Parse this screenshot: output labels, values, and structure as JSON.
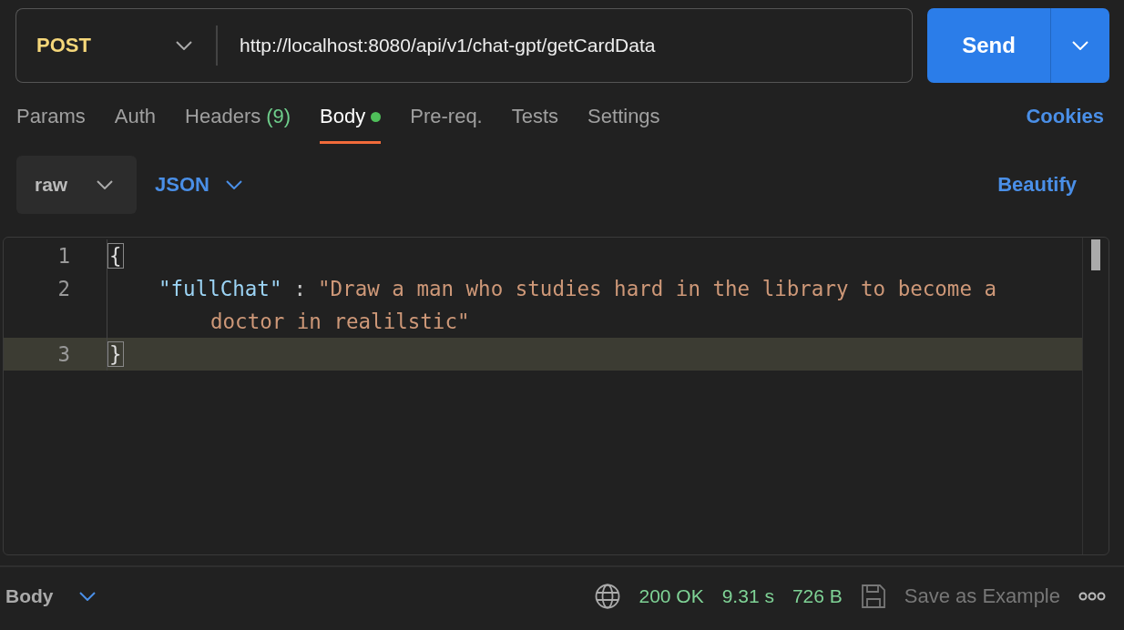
{
  "request": {
    "method": "POST",
    "url": "http://localhost:8080/api/v1/chat-gpt/getCardData",
    "send": "Send"
  },
  "tabs": [
    {
      "label": "Params",
      "selected": false,
      "dot": false
    },
    {
      "label": "Auth",
      "selected": false,
      "dot": false
    },
    {
      "label": "Headers",
      "count": "(9)",
      "selected": false,
      "dot": false
    },
    {
      "label": "Body",
      "selected": true,
      "dot": true
    },
    {
      "label": "Pre-req.",
      "selected": false,
      "dot": false
    },
    {
      "label": "Tests",
      "selected": false,
      "dot": false
    },
    {
      "label": "Settings",
      "selected": false,
      "dot": false
    }
  ],
  "cookies": "Cookies",
  "body_options": {
    "mode": "raw",
    "language": "JSON",
    "beautify": "Beautify"
  },
  "editor": {
    "lines": [
      {
        "number": "1",
        "kind": "brace",
        "text": "{",
        "current": false
      },
      {
        "number": "2",
        "kind": "pair",
        "key": "\"fullChat\"",
        "separator": ":",
        "value_lines": [
          "\"Draw a man who studies hard in the library to become a",
          "doctor in realilstic\""
        ],
        "current": false
      },
      {
        "number": "3",
        "kind": "brace",
        "text": "}",
        "current": true
      }
    ]
  },
  "footer": {
    "label": "Body",
    "status": "200 OK",
    "time": "9.31 s",
    "size": "726 B",
    "save": "Save as Example"
  }
}
